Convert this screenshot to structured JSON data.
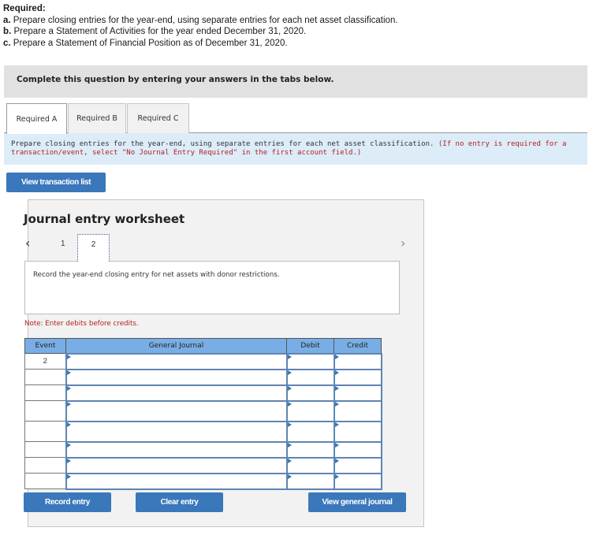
{
  "question": {
    "required_label": "Required:",
    "items": [
      {
        "letter": "a.",
        "text": "Prepare closing entries for the year-end, using separate entries for each net asset classification."
      },
      {
        "letter": "b.",
        "text": "Prepare a Statement of Activities for the year ended December 31, 2020."
      },
      {
        "letter": "c.",
        "text": "Prepare a Statement of Financial Position as of December 31, 2020."
      }
    ]
  },
  "complete_prompt": "Complete this question by entering your answers in the tabs below.",
  "tabs": [
    {
      "label": "Required A",
      "active": true
    },
    {
      "label": "Required B",
      "active": false
    },
    {
      "label": "Required C",
      "active": false
    }
  ],
  "instruction": {
    "text": "Prepare closing entries for the year-end, using separate entries for each net asset classification.",
    "note_red": "(If no entry is required for a transaction/event, select \"No Journal Entry Required\" in the first account field.)"
  },
  "view_transaction_list_label": "View transaction list",
  "worksheet": {
    "title": "Journal entry worksheet",
    "pages": [
      "1",
      "2"
    ],
    "current_page": "2",
    "description": "Record the year-end closing entry for net assets with donor restrictions.",
    "note": "Note: Enter debits before credits.",
    "table": {
      "headers": [
        "Event",
        "General Journal",
        "Debit",
        "Credit"
      ],
      "rows": [
        {
          "event": "2",
          "account": "",
          "debit": "",
          "credit": ""
        },
        {
          "event": "",
          "account": "",
          "debit": "",
          "credit": ""
        },
        {
          "event": "",
          "account": "",
          "debit": "",
          "credit": ""
        },
        {
          "event": "",
          "account": "",
          "debit": "",
          "credit": ""
        },
        {
          "event": "",
          "account": "",
          "debit": "",
          "credit": ""
        },
        {
          "event": "",
          "account": "",
          "debit": "",
          "credit": ""
        },
        {
          "event": "",
          "account": "",
          "debit": "",
          "credit": ""
        },
        {
          "event": "",
          "account": "",
          "debit": "",
          "credit": ""
        }
      ]
    },
    "buttons": {
      "record": "Record entry",
      "clear": "Clear entry",
      "view_journal": "View general journal"
    }
  },
  "colors": {
    "button_blue": "#3a77bb",
    "header_blue": "#78aee5",
    "instruction_bg": "#dcecf8",
    "note_red": "#b52020"
  }
}
